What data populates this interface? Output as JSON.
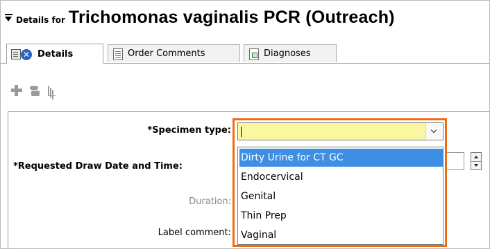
{
  "header": {
    "prefix": "Details for",
    "title": "Trichomonas vaginalis PCR (Outreach)"
  },
  "tabs": [
    {
      "label": "Details",
      "icon": "details-icon",
      "active": true
    },
    {
      "label": "Order Comments",
      "icon": "comments-icon",
      "active": false
    },
    {
      "label": "Diagnoses",
      "icon": "diagnoses-icon",
      "active": false
    }
  ],
  "toolbar": {
    "icons": [
      "add-icon",
      "tray-icon",
      "chart-icon"
    ]
  },
  "form": {
    "specimen_type_label": "*Specimen type:",
    "specimen_type_value": "",
    "draw_date_label": "*Requested Draw Date and Time:",
    "duration_label": "Duration:",
    "label_comment_label": "Label comment:"
  },
  "dropdown": {
    "options": [
      "Dirty Urine for CT GC",
      "Endocervical",
      "Genital",
      "Thin Prep",
      "Vaginal"
    ],
    "selected_index": 0
  },
  "colors": {
    "highlight_border": "#f06b12",
    "selected_option_bg": "#3e8ee3",
    "input_bg": "#fbf6a0"
  }
}
